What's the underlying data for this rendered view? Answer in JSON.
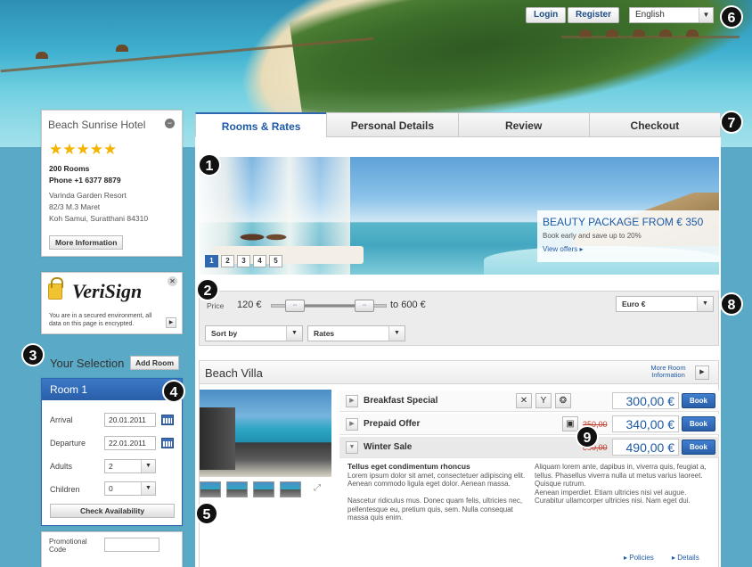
{
  "header": {
    "login_label": "Login",
    "register_label": "Register",
    "language": "English"
  },
  "callouts": [
    "1",
    "2",
    "3",
    "4",
    "5",
    "6",
    "7",
    "8",
    "9"
  ],
  "hotel": {
    "name": "Beach Sunrise Hotel",
    "stars": "★★★★★",
    "rating": 5,
    "rooms": "200 Rooms",
    "phone": "Phone +1 6377 8879",
    "address": [
      "Varinda Garden Resort",
      "82/3 M.3 Maret",
      "Koh Samui, Suratthani 84310"
    ],
    "more_info_label": "More Information"
  },
  "security": {
    "brand": "VeriSign",
    "message": "You are in a secured environment, all data on this page is encrypted."
  },
  "selection": {
    "title": "Your Selection",
    "add_room_label": "Add Room",
    "room_title": "Room 1",
    "arrival_label": "Arrival",
    "arrival": "20.01.2011",
    "departure_label": "Departure",
    "departure": "22.01.2011",
    "adults_label": "Adults",
    "adults": "2",
    "children_label": "Children",
    "children": "0",
    "check_label": "Check Availability",
    "promo_label": "Promotional Code"
  },
  "tabs": [
    "Rooms & Rates",
    "Personal Details",
    "Review",
    "Checkout"
  ],
  "banner": {
    "headline": "BEAUTY PACKAGE  FROM € 350",
    "subline": "Book early and save up to 20%",
    "link": "View offers ▸",
    "pages": [
      "1",
      "2",
      "3",
      "4",
      "5"
    ],
    "active_page": "1"
  },
  "filters": {
    "price_label": "Price",
    "min": "120 €",
    "max": "to 600 €",
    "currency": "Euro €",
    "sort_by": "Sort by",
    "sort_value": "Rates"
  },
  "villa": {
    "title": "Beach Villa",
    "more_room_info": "More Room Information",
    "rates": [
      {
        "name": "Breakfast Special",
        "old_price": "",
        "price": "300,00 €",
        "book": "Book"
      },
      {
        "name": "Prepaid Offer",
        "old_price": "350,00",
        "price": "340,00 €",
        "book": "Book"
      },
      {
        "name": "Winter Sale",
        "old_price": "550,00",
        "price": "490,00 €",
        "book": "Book"
      }
    ],
    "desc_title": "Tellus eget condimentum rhoncus",
    "desc_p1": "Lorem ipsum dolor sit amet, consectetuer adipiscing elit. Aenean commodo ligula eget dolor. Aenean massa.",
    "desc_p2": "Nascetur ridiculus mus. Donec quam felis, ultricies nec, pellentesque eu, pretium quis, sem. Nulla consequat massa quis enim.",
    "desc_r1": "Aliquam lorem ante, dapibus in, viverra quis, feugiat a, tellus. Phasellus viverra nulla ut metus varius laoreet. Quisque rutrum.",
    "desc_r2": "Aenean imperdiet. Etiam ultricies nisi vel augue. Curabitur ullamcorper ultricies nisi. Nam eget dui.",
    "policies": "▸ Policies",
    "details": "▸ Details"
  }
}
